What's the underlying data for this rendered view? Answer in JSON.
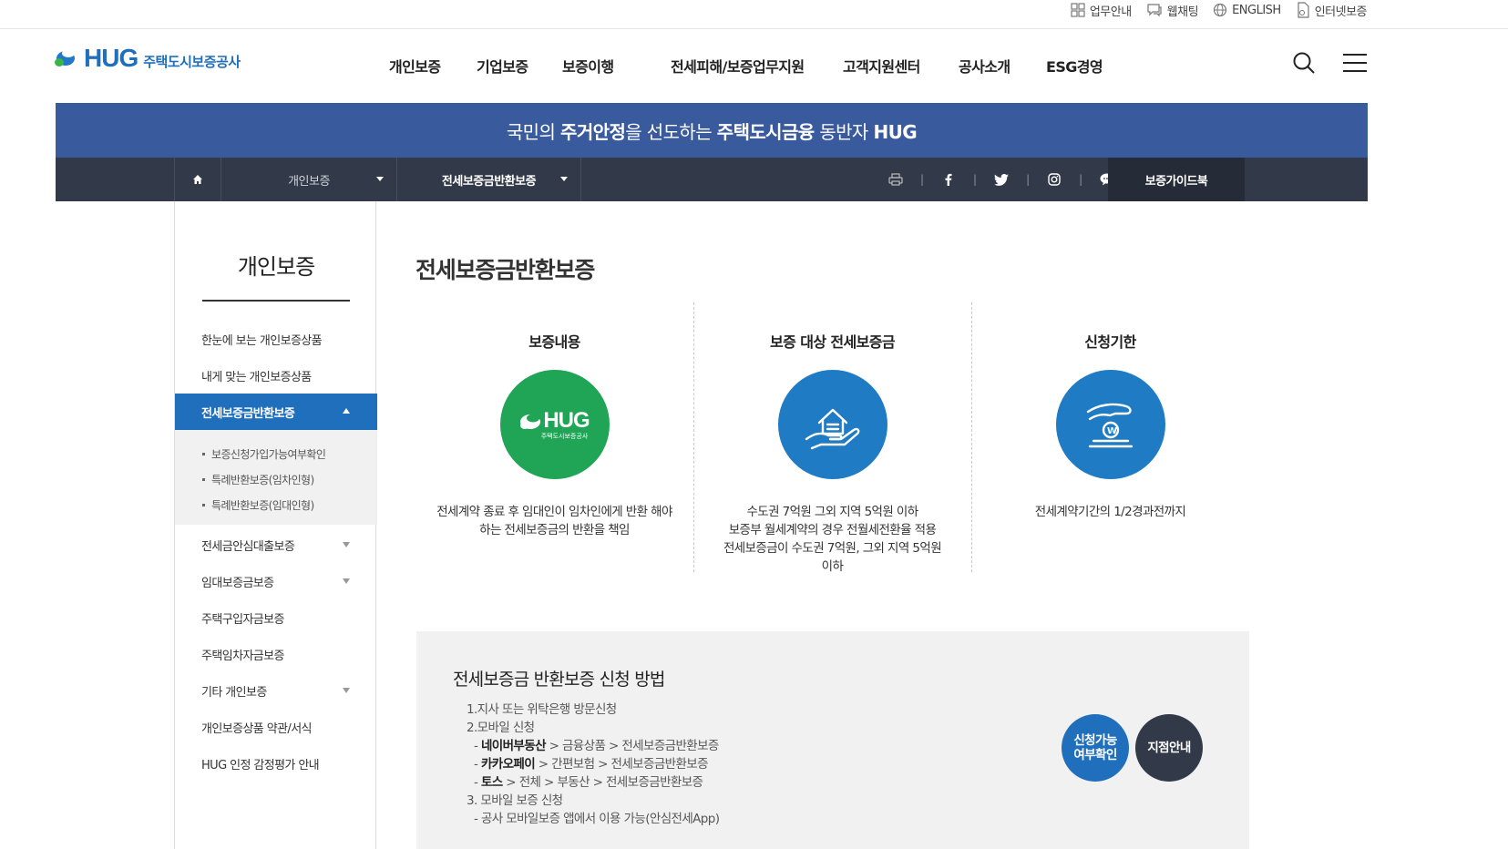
{
  "utility": {
    "links": [
      {
        "label": "업무안내",
        "icon": "grid-icon"
      },
      {
        "label": "웹채팅",
        "icon": "chat-bubble-icon"
      },
      {
        "label": "ENGLISH",
        "icon": "globe-icon"
      },
      {
        "label": "인터넷보증",
        "icon": "document-icon"
      }
    ]
  },
  "header": {
    "logo_text": "HUG",
    "logo_sub": "주택도시보증공사",
    "nav": [
      "개인보증",
      "기업보증",
      "보증이행",
      "전세피해/보증업무지원",
      "고객지원센터",
      "공사소개",
      "ESG경영"
    ]
  },
  "banner": {
    "pre": "국민의 ",
    "strong1": "주거안정",
    "mid": "을 선도하는 ",
    "strong2": "주택도시금융",
    "post": " 동반자 ",
    "strong3": "HUG"
  },
  "location": {
    "depth1": "개인보증",
    "depth2": "전세보증금반환보증",
    "guidebook": "보증가이드북",
    "share_icons": [
      "print-icon",
      "facebook-icon",
      "twitter-icon",
      "instagram-icon",
      "kakao-talk-icon"
    ]
  },
  "sidebar": {
    "title": "개인보증",
    "items": [
      {
        "label": "한눈에 보는 개인보증상품"
      },
      {
        "label": "내게 맞는 개인보증상품"
      },
      {
        "label": "전세보증금반환보증",
        "active": true
      },
      {
        "label": "전세금안심대출보증",
        "has_children": true
      },
      {
        "label": "임대보증금보증",
        "has_children": true
      },
      {
        "label": "주택구입자금보증"
      },
      {
        "label": "주택임차자금보증"
      },
      {
        "label": "기타 개인보증",
        "has_children": true
      },
      {
        "label": "개인보증상품 약관/서식"
      },
      {
        "label": "HUG 인정 감정평가 안내"
      }
    ],
    "sub_items": [
      "보증신청가입가능여부확인",
      "특례반환보증(임차인형)",
      "특례반환보증(임대인형)"
    ]
  },
  "main": {
    "title": "전세보증금반환보증",
    "columns": [
      {
        "heading": "보증내용",
        "icon": "hug-logo-icon",
        "color": "#1fa555",
        "text": "전세계약 종료 후 임대인이 임차인에게 반환 해야\n하는 전세보증금의 반환을 책임"
      },
      {
        "heading": "보증 대상 전세보증금",
        "icon": "house-in-hand-icon",
        "color": "#1f7bc4",
        "text": "수도권 7억원 그외 지역 5억원 이하\n보증부 월세계약의 경우 전월세전환율 적용\n전세보증금이 수도권 7억원, 그외 지역 5억원\n이하"
      },
      {
        "heading": "신청기한",
        "icon": "hand-coin-icon",
        "color": "#1f7bc4",
        "text": "전세계약기간의 1/2경과전까지"
      }
    ],
    "hug_circle_text": "HUG",
    "hug_circle_sub": "주택도시보증공사",
    "apply": {
      "title": "전세보증금 반환보증 신청 방법",
      "line1": "1.지사 또는 위탁은행 방문신청",
      "line2": "2.모바일 신청",
      "line3_strong": "네이버부동산",
      "line3_rest": " > 금융상품 > 전세보증금반환보증",
      "line4_strong": "카카오페이",
      "line4_rest": " > 간편보험 > 전세보증금반환보증",
      "line5_strong": "토스",
      "line5_rest": " > 전체 > 부동산 > 전세보증금반환보증",
      "line6": "3. 모바일 보증 신청",
      "line7": "- 공사 모바일보증 앱에서 이용 가능(안심전세App)",
      "button1": "신청가능\n여부확인",
      "button2": "지점안내"
    }
  },
  "colors": {
    "primary": "#1f6fbd",
    "banner": "#3a5a9e",
    "locbar": "#323a49",
    "green": "#1fa555"
  }
}
